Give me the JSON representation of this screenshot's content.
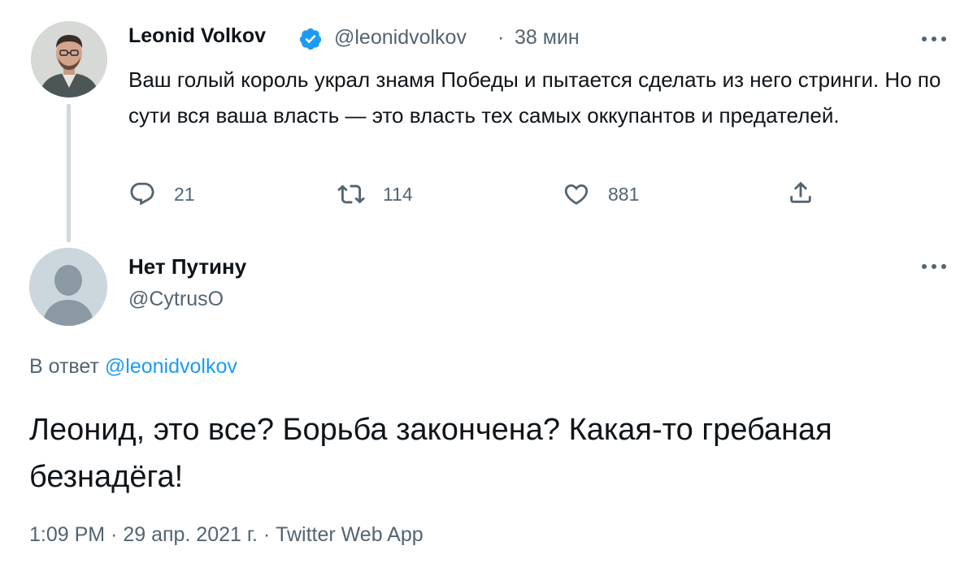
{
  "parent_tweet": {
    "author_name": "Leonid Volkov",
    "handle": "@leonidvolkov",
    "separator": "·",
    "time": "38 мин",
    "text": "Ваш голый король украл знамя Победы и пытается сделать из него стринги. Но по сути вся ваша власть  — это власть тех самых оккупантов и предателей.",
    "actions": {
      "replies": "21",
      "retweets": "114",
      "likes": "881"
    }
  },
  "reply_tweet": {
    "author_name": "Нет Путину",
    "handle": "@CytrusO",
    "reply_prefix": "В ответ",
    "reply_to": "@leonidvolkov",
    "text": "Леонид, это все? Борьба закончена? Какая-то гребаная безнадёга!",
    "meta": "1:09 PM · 29 апр. 2021 г. · Twitter Web App"
  },
  "icons": {
    "verified": "verified-badge-icon",
    "reply": "reply-icon",
    "retweet": "retweet-icon",
    "like": "heart-icon",
    "share": "share-icon",
    "more": "more-horizontal-icon"
  },
  "colors": {
    "verified_blue": "#1d9bf0",
    "secondary_text": "#536471",
    "primary_text": "#0f1419",
    "link": "#1d9bf0",
    "thread_line": "#cfd9de"
  }
}
